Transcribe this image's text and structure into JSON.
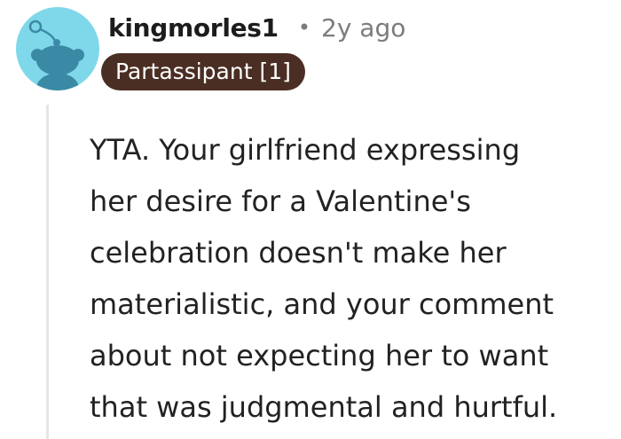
{
  "comment": {
    "author": "kingmorles1",
    "separator": "•",
    "age": "2y ago",
    "flair": "Partassipant [1]",
    "body_lines": [
      "YTA. Your girlfriend expressing",
      "her desire for a Valentine's",
      "celebration doesn't make her",
      "materialistic, and your comment",
      "about not expecting her to want",
      "that was judgmental and hurtful."
    ]
  },
  "colors": {
    "avatar_bg": "#7fd8e9",
    "avatar_figure": "#3a8aa6",
    "flair_bg": "#4b2e23",
    "flair_text": "#ffffff",
    "meta_text": "#7c7c7c",
    "thread_line": "#e6e6e6"
  },
  "icons": {
    "avatar": "snoo-avatar-icon"
  }
}
